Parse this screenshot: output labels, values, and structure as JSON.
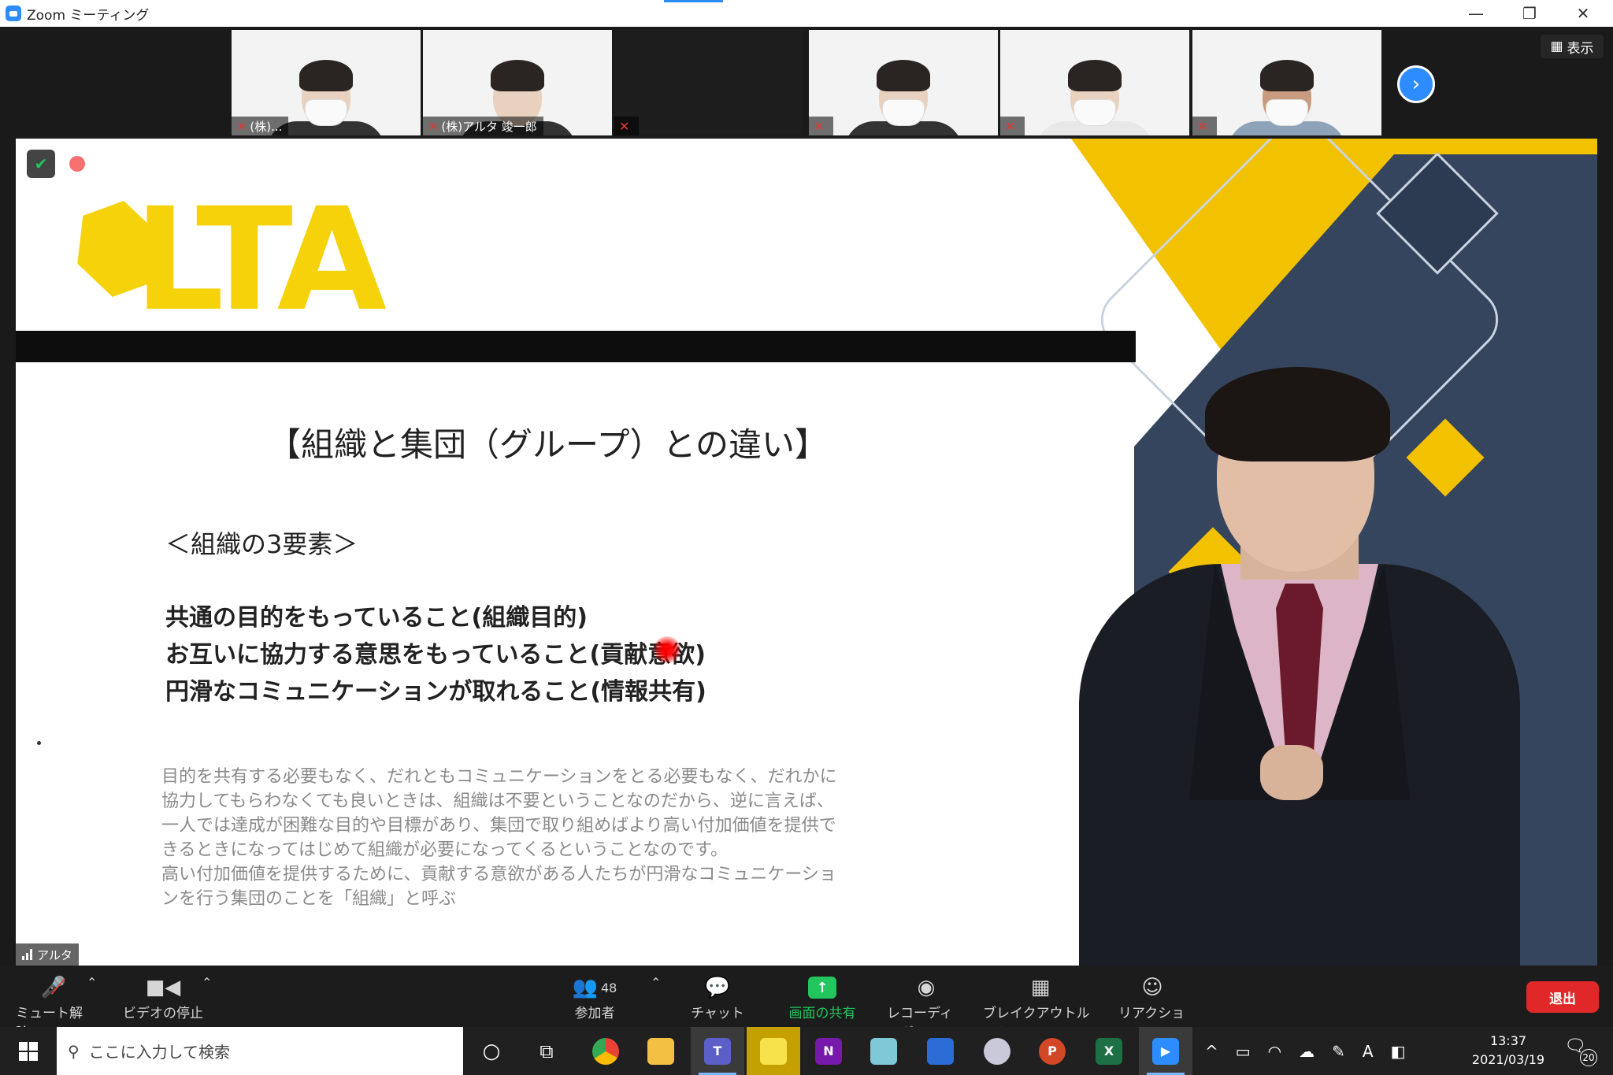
{
  "window": {
    "title": "Zoom ミーティング",
    "minimize_icon": "minimize-icon",
    "restore_icon": "restore-icon",
    "close_icon": "close-icon"
  },
  "thumbnails": [
    {
      "label": "(株)...",
      "muted": true
    },
    {
      "label": "(株)アルタ 竣一郎",
      "muted": true
    },
    {
      "label": "",
      "muted": true,
      "video_off": true
    },
    {
      "label": "",
      "muted": true
    },
    {
      "label": "",
      "muted": true
    },
    {
      "label": "",
      "muted": true
    }
  ],
  "view_button": {
    "label": "表示"
  },
  "slide": {
    "logo_text": "LTA",
    "title": "【組織と集団（グループ）との違い】",
    "subtitle": "＜組織の3要素＞",
    "items": [
      "共通の目的をもっていること(組織目的)",
      "お互いに協力する意思をもっていること(貢献意欲)",
      "円滑なコミュニケーションが取れること(情報共有)"
    ],
    "body": [
      "目的を共有する必要もなく、だれともコミュニケーションをとる必要もなく、だれかに",
      "協力してもらわなくても良いときは、組織は不要ということなのだから、逆に言えば、",
      "一人では達成が困難な目的や目標があり、集団で取り組めばより高い付加価値を提供で",
      "きるときになってはじめて組織が必要になってくるということなのです。",
      "高い付加価値を提供するために、貢献する意欲がある人たちが円滑なコミュニケーショ",
      "ンを行う集団のことを「組織」と呼ぶ"
    ]
  },
  "speaker_name": "アルタ",
  "toolbar": {
    "unmute": "ミュート解除",
    "stop_video": "ビデオの停止",
    "participants": "参加者",
    "participants_count": "48",
    "chat": "チャット",
    "share": "画面の共有",
    "recording": "レコーディング",
    "breakout": "ブレイクアウトルーム",
    "reaction": "リアクション",
    "leave": "退出"
  },
  "taskbar": {
    "search_placeholder": "ここに入力して検索",
    "time": "13:37",
    "date": "2021/03/19",
    "notification_count": "20",
    "ime": "A"
  },
  "colors": {
    "zoom_blue": "#2d8cff",
    "share_green": "#22c55e",
    "leave_red": "#e02828",
    "logo_yellow": "#f5d20a"
  }
}
